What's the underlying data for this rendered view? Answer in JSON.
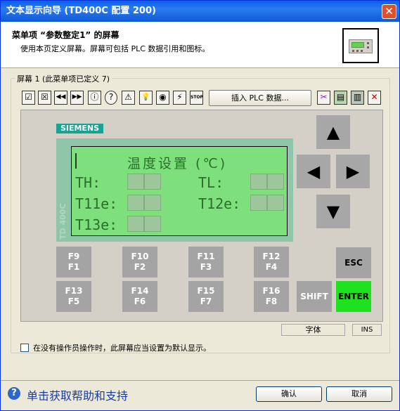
{
  "window": {
    "title": "文本显示向导 (TD400C 配置 200)",
    "close_label": "✕"
  },
  "header": {
    "title": "菜单项 “参数整定1” 的屏幕",
    "subtitle": "使用本页定义屏幕。屏幕可包括 PLC 数据引用和图标。"
  },
  "group": {
    "label": "屏幕 1 (此菜单项已定义 7)"
  },
  "toolbar": {
    "icons": [
      "☑",
      "☒",
      "◀◀",
      "▶▶",
      "ⓘ",
      "?",
      "⚠",
      "💡",
      "◉",
      "⚡",
      "STOP"
    ],
    "insert_label": "插入 PLC 数据..."
  },
  "device": {
    "brand": "SIEMENS",
    "model_vertical": "TD 400C",
    "lcd": {
      "title": "温度设置 (℃)",
      "th": "TH:",
      "tl": "TL:",
      "t11e": "T11e:",
      "t12e": "T12e:",
      "t13e": "T13e:"
    },
    "arrows": {
      "up": "▲",
      "left": "◀",
      "right": "▶",
      "down": "▼"
    },
    "fkeys": [
      {
        "top": "F9",
        "bottom": "F1"
      },
      {
        "top": "F10",
        "bottom": "F2"
      },
      {
        "top": "F11",
        "bottom": "F3"
      },
      {
        "top": "F12",
        "bottom": "F4"
      },
      {
        "top": "F13",
        "bottom": "F5"
      },
      {
        "top": "F14",
        "bottom": "F6"
      },
      {
        "top": "F15",
        "bottom": "F7"
      },
      {
        "top": "F16",
        "bottom": "F8"
      }
    ],
    "esc": "ESC",
    "shift": "SHIFT",
    "enter": "ENTER"
  },
  "status": {
    "font_label": "字体",
    "mode": "INS"
  },
  "option": {
    "checkbox_label": "在没有操作员操作时，此屏幕应当设置为默认显示。",
    "checked": false
  },
  "footer": {
    "help_text": "单击获取帮助和支持",
    "ok_label": "确认",
    "cancel_label": "取消"
  },
  "colors": {
    "lcd_green": "#7ee07c",
    "enter_green": "#1fe11f",
    "title_blue": "#0a5fe8"
  }
}
